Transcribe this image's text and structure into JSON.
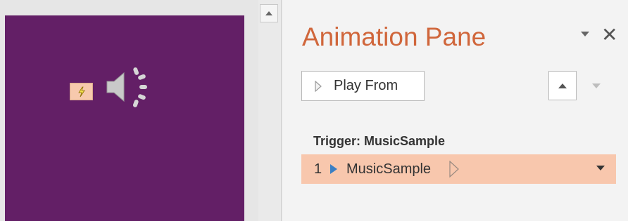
{
  "pane": {
    "title": "Animation Pane",
    "play_from_label": "Play From"
  },
  "trigger": {
    "label": "Trigger: MusicSample"
  },
  "animation_items": [
    {
      "number": "1",
      "name": "MusicSample"
    }
  ],
  "colors": {
    "slide_background": "#631f66",
    "title_accent": "#d0663b",
    "selected_row": "#f8c7ad",
    "play_icon": "#3a7fc4"
  },
  "icons": {
    "trigger": "lightning-icon",
    "audio": "speaker-icon",
    "play": "play-triangle-icon",
    "timing": "timing-bar-icon",
    "dropdown": "chevron-down-icon",
    "close": "close-icon",
    "move_up": "arrow-up-icon",
    "move_down": "arrow-down-icon"
  }
}
